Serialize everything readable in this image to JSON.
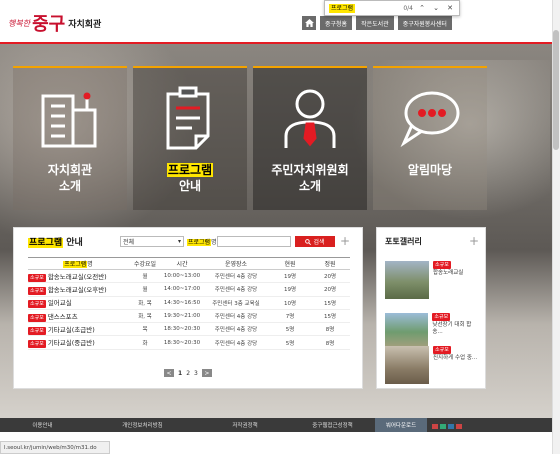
{
  "header": {
    "logo_slogan": "행복한",
    "logo_main": "중구",
    "logo_sub": "자치회관",
    "nav": [
      "중구청홈",
      "작은도서관",
      "중구자원봉사센터"
    ]
  },
  "find_bar": {
    "query": "프로그램",
    "count": "0/4",
    "prev": "⌃",
    "next": "⌄",
    "close": "✕"
  },
  "tiles": [
    {
      "line1": "자치회관",
      "line2": "소개",
      "icon": "building-icon"
    },
    {
      "line1": "프로그램",
      "line2": "안내",
      "icon": "document-icon",
      "highlight": true
    },
    {
      "line1": "주민자치위원회",
      "line2": "소개",
      "icon": "person-icon"
    },
    {
      "line1": "알림마당",
      "line2": "",
      "icon": "speech-bubble-icon"
    }
  ],
  "program": {
    "title_hl": "프로그램",
    "title_rest": " 안내",
    "select_value": "전체",
    "input_label_hl": "프로그램",
    "input_label_rest": "명",
    "search_label": "검색",
    "headers": {
      "name_hl": "프로그램",
      "name_rest": "명",
      "day": "수강요일",
      "time": "시간",
      "place": "운영장소",
      "now": "현원",
      "cap": "정원"
    },
    "rows": [
      {
        "tag": "소규모",
        "name": "합송노래교실(오전반)",
        "day": "월",
        "time": "10:00~13:00",
        "place": "주민센터 4층 강당",
        "now": "19명",
        "cap": "20명"
      },
      {
        "tag": "소규모",
        "name": "합송노래교실(오후반)",
        "day": "월",
        "time": "14:00~17:00",
        "place": "주민센터 4층 강당",
        "now": "19명",
        "cap": "20명"
      },
      {
        "tag": "소규모",
        "name": "일어교실",
        "day": "화, 목",
        "time": "14:30~16:50",
        "place": "주민센터 3층 교육실",
        "now": "10명",
        "cap": "15명"
      },
      {
        "tag": "소규모",
        "name": "댄스스포츠",
        "day": "화, 목",
        "time": "19:30~21:00",
        "place": "주민센터 4층 강당",
        "now": "7명",
        "cap": "15명"
      },
      {
        "tag": "소규모",
        "name": "기타교실(초급반)",
        "day": "목",
        "time": "18:30~20:30",
        "place": "주민센터 4층 강당",
        "now": "5명",
        "cap": "8명"
      },
      {
        "tag": "소규모",
        "name": "기타교실(중급반)",
        "day": "화",
        "time": "18:30~20:30",
        "place": "주민센터 4층 강당",
        "now": "5명",
        "cap": "8명"
      }
    ],
    "pages": [
      "1",
      "2",
      "3"
    ],
    "prev": "<",
    "next": ">"
  },
  "gallery": {
    "title": "포토갤러리",
    "items": [
      {
        "tag": "소규모",
        "title": "합송노래교실"
      },
      {
        "tag": "소규모",
        "title": "낮선장기 대회 합송..."
      },
      {
        "tag": "소규모",
        "title": "진지하게 수업 중..."
      }
    ]
  },
  "footer": {
    "items": [
      "이용안내",
      "개인정보처리방침",
      "저작권정책",
      "중구웹접근성정책",
      "붜어다운로드"
    ]
  },
  "status_url": "l.seoul.kr/jumin/web/m30/m31.do",
  "colors": {
    "accent": "#e31b23",
    "tile_border": "#f4a300",
    "highlight": "#ffe600"
  }
}
